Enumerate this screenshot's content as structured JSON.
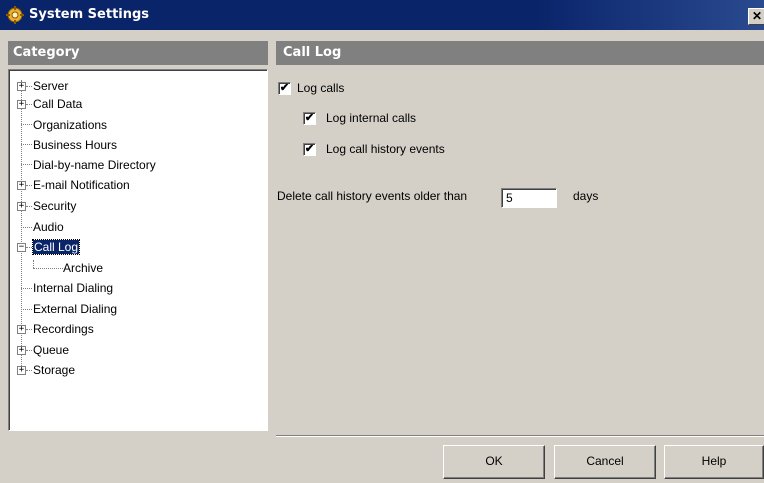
{
  "window": {
    "title": "System Settings",
    "close_label": "✕"
  },
  "category": {
    "header": "Category",
    "items": [
      {
        "label": "Server",
        "expander": "+"
      },
      {
        "label": "Call Data",
        "expander": "+"
      },
      {
        "label": "Organizations"
      },
      {
        "label": "Business Hours"
      },
      {
        "label": "Dial-by-name Directory"
      },
      {
        "label": "E-mail Notification",
        "expander": "+"
      },
      {
        "label": "Security",
        "expander": "+"
      },
      {
        "label": "Audio"
      },
      {
        "label": "Call Log",
        "expander": "−",
        "selected": true
      },
      {
        "label": "Archive",
        "child": true
      },
      {
        "label": "Internal Dialing"
      },
      {
        "label": "External Dialing"
      },
      {
        "label": "Recordings",
        "expander": "+"
      },
      {
        "label": "Queue",
        "expander": "+"
      },
      {
        "label": "Storage",
        "expander": "+"
      }
    ]
  },
  "panel": {
    "header": "Call Log",
    "log_calls": {
      "label": "Log calls",
      "checked": true
    },
    "log_internal": {
      "label": "Log internal calls",
      "checked": true
    },
    "log_history": {
      "label": "Log call history events",
      "checked": true
    },
    "delete_label": "Delete call history events older than",
    "days_value": "5",
    "days_unit": "days"
  },
  "buttons": {
    "ok": "OK",
    "cancel": "Cancel",
    "help": "Help"
  },
  "check_mark": "✔"
}
